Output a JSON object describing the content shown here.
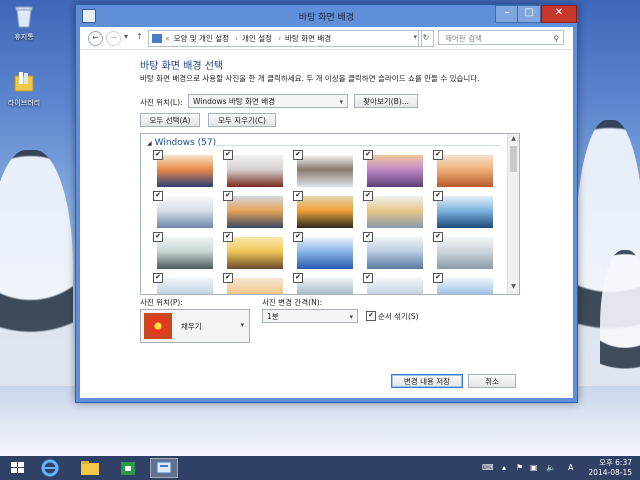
{
  "desktop": {
    "icons": [
      {
        "label": "휴지통"
      },
      {
        "label": "라이브러리"
      }
    ]
  },
  "window": {
    "title": "바탕 화면 배경",
    "controls": {
      "minimize": "–",
      "maximize": "□",
      "close": "✕"
    },
    "nav": {
      "back": "←",
      "forward": "→",
      "recent": "▾",
      "up": "↑",
      "breadcrumb": [
        "«",
        "모양 및 개인 설정",
        "개인 설정",
        "바탕 화면 배경"
      ],
      "search_placeholder": "제어판 검색",
      "refresh": "↻"
    },
    "heading": "바탕 화면 배경 선택",
    "description": "바탕 화면 배경으로 사용할 사진을 한 개 클릭하세요. 두 개 이상을 클릭하면 슬라이드 쇼를 만들 수 있습니다.",
    "picture_location_label": "사진 위치(L):",
    "picture_location_value": "Windows 바탕 화면 배경",
    "browse_button": "찾아보기(B)...",
    "select_all_button": "모두 선택(A)",
    "clear_all_button": "모두 지우기(C)",
    "gallery": {
      "group_label": "Windows (57)",
      "thumbnails": [
        {
          "scene": "snow-sunrise",
          "checked": true,
          "colors": [
            "#2d3f7a",
            "#e98a4a",
            "#f6e6c9"
          ]
        },
        {
          "scene": "red-trees",
          "checked": true,
          "colors": [
            "#7a2a1f",
            "#d7d2cf",
            "#f2f2f2"
          ]
        },
        {
          "scene": "snow-forest",
          "checked": true,
          "colors": [
            "#dce2e8",
            "#8a7a6e",
            "#f7f7f7"
          ]
        },
        {
          "scene": "purple-dusk",
          "checked": true,
          "colors": [
            "#5b3f7a",
            "#c28ac8",
            "#f2c79a"
          ]
        },
        {
          "scene": "amber-forest",
          "checked": true,
          "colors": [
            "#b85a2a",
            "#f0b07a",
            "#f4e2cc"
          ]
        },
        {
          "scene": "snow-tree",
          "checked": true,
          "colors": [
            "#6c86a8",
            "#d8e0ea",
            "#fafafa"
          ]
        },
        {
          "scene": "creek-sunset",
          "checked": true,
          "colors": [
            "#3a4a5e",
            "#e8a45a",
            "#cfd8e0"
          ]
        },
        {
          "scene": "sunbeams",
          "checked": true,
          "colors": [
            "#2c2a20",
            "#f0a23a",
            "#e6d6b0"
          ]
        },
        {
          "scene": "frost-trees",
          "checked": true,
          "colors": [
            "#8c9aa8",
            "#e8c88a",
            "#eef0f2"
          ]
        },
        {
          "scene": "blue-pines",
          "checked": true,
          "colors": [
            "#1d4a7a",
            "#7fb6e0",
            "#e4eef6"
          ]
        },
        {
          "scene": "frozen-lake",
          "checked": true,
          "colors": [
            "#4a5a5a",
            "#c8d6d6",
            "#f0f4f4"
          ]
        },
        {
          "scene": "golden-trees",
          "checked": true,
          "colors": [
            "#6a4a2a",
            "#f0c85a",
            "#fbe8b0"
          ]
        },
        {
          "scene": "blue-ridge",
          "checked": true,
          "colors": [
            "#2a5ab0",
            "#8ab6e8",
            "#eef4fb"
          ]
        },
        {
          "scene": "mountains",
          "checked": true,
          "colors": [
            "#5a7aa0",
            "#b8cce0",
            "#f4f6f8"
          ]
        },
        {
          "scene": "pale-woods",
          "checked": true,
          "colors": [
            "#8a9aa8",
            "#cdd6dc",
            "#f3f5f6"
          ]
        },
        {
          "scene": "partial-1",
          "checked": true,
          "colors": [
            "#6a86b0",
            "#c8d6e6",
            "#f0f4f8"
          ]
        },
        {
          "scene": "partial-2",
          "checked": true,
          "colors": [
            "#b87a3a",
            "#f0c890",
            "#f6e8d6"
          ]
        },
        {
          "scene": "partial-3",
          "checked": true,
          "colors": [
            "#5a6a7a",
            "#b0c0cc",
            "#eef2f4"
          ]
        },
        {
          "scene": "partial-4",
          "checked": true,
          "colors": [
            "#7a8aa0",
            "#ccd8e4",
            "#f4f6f9"
          ]
        },
        {
          "scene": "partial-5",
          "checked": true,
          "colors": [
            "#4a7ab0",
            "#a8c8e8",
            "#f0f4f9"
          ]
        }
      ]
    },
    "picture_position_label": "사진 위치(P):",
    "picture_position_value": "채우기",
    "interval_label": "사진 변경 간격(N):",
    "interval_value": "1분",
    "shuffle_label": "순서 섞기(S)",
    "shuffle_checked": true,
    "save_button": "변경 내용 저장",
    "cancel_button": "취소"
  },
  "taskbar": {
    "items": [
      "start",
      "ie",
      "explorer",
      "store",
      "control-panel"
    ],
    "tray_lang": "A",
    "time": "오후 6:37",
    "date": "2014-08-15"
  }
}
